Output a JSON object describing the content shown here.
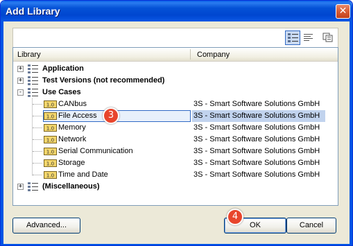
{
  "window": {
    "title": "Add Library",
    "close_glyph": "✕"
  },
  "toolbar": {
    "buttons": [
      "category-view-icon",
      "list-view-icon",
      "details-icon"
    ]
  },
  "columns": {
    "library": "Library",
    "company": "Company"
  },
  "tree": [
    {
      "label": "Application",
      "bold": true,
      "level": 0,
      "expander": "+",
      "icon": "category-icon",
      "company": ""
    },
    {
      "label": "Test Versions (not recommended)",
      "bold": true,
      "level": 0,
      "expander": "+",
      "icon": "category-icon",
      "company": ""
    },
    {
      "label": "Use Cases",
      "bold": true,
      "level": 0,
      "expander": "-",
      "icon": "category-icon",
      "company": ""
    },
    {
      "label": "CANbus",
      "bold": false,
      "level": 1,
      "icon": "library-icon",
      "company": "3S - Smart Software Solutions GmbH"
    },
    {
      "label": "File Access",
      "bold": false,
      "level": 1,
      "icon": "library-icon",
      "company": "3S - Smart Software Solutions GmbH",
      "selected": true
    },
    {
      "label": "Memory",
      "bold": false,
      "level": 1,
      "icon": "library-icon",
      "company": "3S - Smart Software Solutions GmbH"
    },
    {
      "label": "Network",
      "bold": false,
      "level": 1,
      "icon": "library-icon",
      "company": "3S - Smart Software Solutions GmbH"
    },
    {
      "label": "Serial Communication",
      "bold": false,
      "level": 1,
      "icon": "library-icon",
      "company": "3S - Smart Software Solutions GmbH"
    },
    {
      "label": "Storage",
      "bold": false,
      "level": 1,
      "icon": "library-icon",
      "company": "3S - Smart Software Solutions GmbH"
    },
    {
      "label": "Time and Date",
      "bold": false,
      "level": 1,
      "icon": "library-icon",
      "company": "3S - Smart Software Solutions GmbH"
    },
    {
      "label": "(Miscellaneous)",
      "bold": true,
      "level": 0,
      "expander": "+",
      "icon": "category-icon",
      "company": ""
    }
  ],
  "library_icon_text": "1.0",
  "badges": [
    "3",
    "4"
  ],
  "buttons": {
    "advanced": "Advanced...",
    "ok": "OK",
    "cancel": "Cancel"
  },
  "colors": {
    "title_bar": "#0055e5",
    "selection": "#c1d3ee",
    "badge": "#e8452c"
  }
}
